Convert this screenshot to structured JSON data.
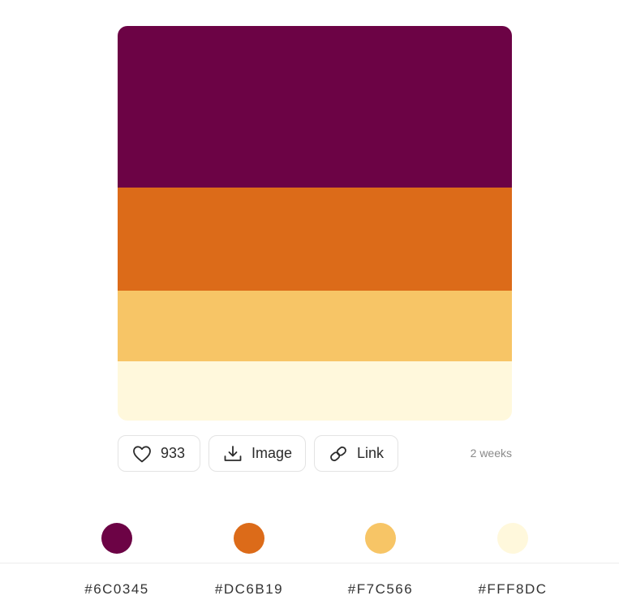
{
  "palette": {
    "colors": [
      "#6C0345",
      "#DC6B19",
      "#F7C566",
      "#FFF8DC"
    ]
  },
  "actions": {
    "like_icon": "heart-icon",
    "like_count": "933",
    "image_icon": "download-icon",
    "image_label": "Image",
    "link_icon": "link-icon",
    "link_label": "Link",
    "timestamp": "2 weeks"
  },
  "swatches": [
    {
      "hex": "#6C0345",
      "color": "#6C0345"
    },
    {
      "hex": "#DC6B19",
      "color": "#DC6B19"
    },
    {
      "hex": "#F7C566",
      "color": "#F7C566"
    },
    {
      "hex": "#FFF8DC",
      "color": "#FFF8DC"
    }
  ]
}
